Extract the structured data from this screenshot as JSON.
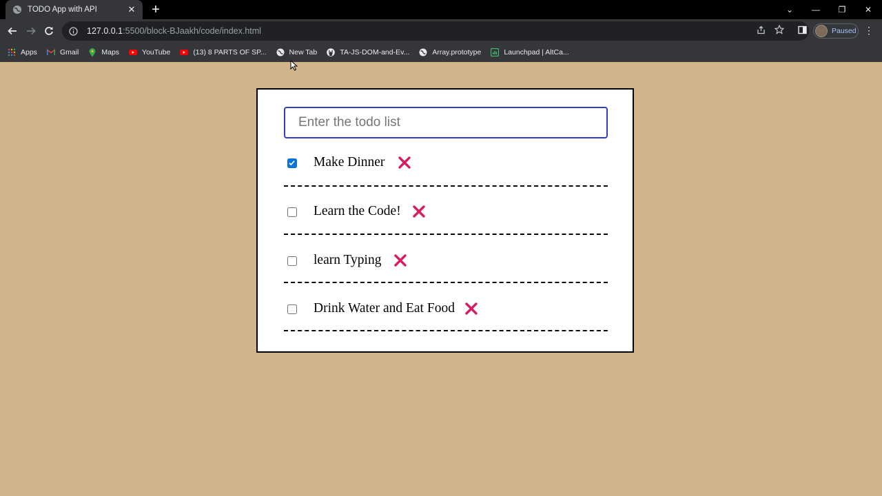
{
  "browser": {
    "tab": {
      "title": "TODO App with API",
      "close": "✕"
    },
    "new_tab": "+",
    "window_controls": {
      "minimize": "—",
      "restore": "❐",
      "close": "✕",
      "tab_search": "⌄"
    },
    "url": {
      "host": "127.0.0.1",
      "path": ":5500/block-BJaakh/code/index.html"
    },
    "profile": {
      "status": "Paused"
    },
    "bookmarks": [
      {
        "label": "Apps",
        "icon": "apps-grid-icon"
      },
      {
        "label": "Gmail",
        "icon": "gmail-icon"
      },
      {
        "label": "Maps",
        "icon": "maps-icon"
      },
      {
        "label": "YouTube",
        "icon": "youtube-icon"
      },
      {
        "label": "(13) 8 PARTS OF SP...",
        "icon": "youtube-icon"
      },
      {
        "label": "New Tab",
        "icon": "globe-icon"
      },
      {
        "label": "TA-JS-DOM-and-Ev...",
        "icon": "github-icon"
      },
      {
        "label": "Array.prototype",
        "icon": "globe-icon"
      },
      {
        "label": "Launchpad | AltCa...",
        "icon": "launchpad-icon"
      }
    ]
  },
  "app": {
    "input": {
      "placeholder": "Enter the todo list",
      "value": ""
    },
    "todos": [
      {
        "text": "Make Dinner",
        "completed": true
      },
      {
        "text": "Learn the Code!",
        "completed": false
      },
      {
        "text": "learn Typing",
        "completed": false
      },
      {
        "text": "Drink Water and Eat Food",
        "completed": false
      }
    ],
    "colors": {
      "background": "#d2b48c",
      "input_border": "#2f3fc2",
      "delete": "#d81b60",
      "checkbox_checked": "#0b74d9"
    }
  }
}
